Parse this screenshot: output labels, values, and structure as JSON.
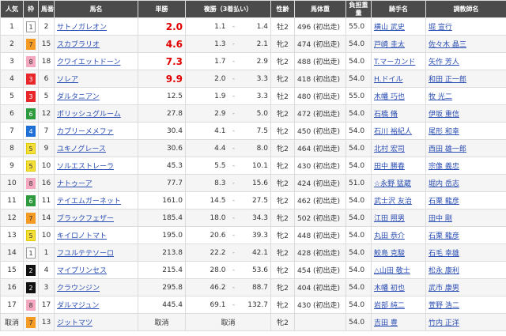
{
  "header": {
    "rank": "人気",
    "gate": "枠",
    "number": "馬番",
    "horse": "馬名",
    "win": "単勝",
    "place": "複勝（3着払い）",
    "sex_age": "性齢",
    "body_weight": "馬体重",
    "carried_weight": "負担重量",
    "jockey": "騎手名",
    "trainer": "調教師名"
  },
  "scratched_label": "取消",
  "gate_colors": {
    "1": {
      "bg": "#ffffff",
      "fg": "#333333",
      "border": "#999999"
    },
    "2": {
      "bg": "#111111",
      "fg": "#ffffff",
      "border": "#111111"
    },
    "3": {
      "bg": "#e8272b",
      "fg": "#ffffff",
      "border": "#e8272b"
    },
    "4": {
      "bg": "#1e6fd6",
      "fg": "#ffffff",
      "border": "#1e6fd6"
    },
    "5": {
      "bg": "#f5e03b",
      "fg": "#333333",
      "border": "#e0c800"
    },
    "6": {
      "bg": "#2e9a3e",
      "fg": "#ffffff",
      "border": "#2e9a3e"
    },
    "7": {
      "bg": "#f59a23",
      "fg": "#333333",
      "border": "#f59a23"
    },
    "8": {
      "bg": "#f4a9c0",
      "fg": "#333333",
      "border": "#f4a9c0"
    }
  },
  "rows": [
    {
      "rank": "1",
      "gate": "1",
      "number": "2",
      "horse": "サトノガレオン",
      "win": "2.0",
      "win_hot": true,
      "place_lo": "1.1",
      "place_hi": "1.4",
      "sex_age": "牡2",
      "body_weight": "496 (初出走)",
      "carried_weight": "55.0",
      "jockey": "横山 武史",
      "trainer": "堀 宣行"
    },
    {
      "rank": "2",
      "gate": "7",
      "number": "15",
      "horse": "スカブラリオ",
      "win": "4.6",
      "win_hot": true,
      "place_lo": "1.3",
      "place_hi": "2.1",
      "sex_age": "牝2",
      "body_weight": "474 (初出走)",
      "carried_weight": "54.0",
      "jockey": "戸崎 圭太",
      "trainer": "佐々木 晶三"
    },
    {
      "rank": "3",
      "gate": "8",
      "number": "18",
      "horse": "クワイエットドーン",
      "win": "7.3",
      "win_hot": true,
      "place_lo": "1.7",
      "place_hi": "2.9",
      "sex_age": "牝2",
      "body_weight": "488 (初出走)",
      "carried_weight": "54.0",
      "jockey": "T.マーカンド",
      "trainer": "矢作 芳人"
    },
    {
      "rank": "4",
      "gate": "3",
      "number": "6",
      "horse": "ソレア",
      "win": "9.9",
      "win_hot": true,
      "place_lo": "2.0",
      "place_hi": "3.3",
      "sex_age": "牝2",
      "body_weight": "418 (初出走)",
      "carried_weight": "54.0",
      "jockey": "H.ドイル",
      "trainer": "和田 正一郎"
    },
    {
      "rank": "5",
      "gate": "3",
      "number": "5",
      "horse": "ダルタニアン",
      "win": "12.5",
      "win_hot": false,
      "place_lo": "1.9",
      "place_hi": "3.3",
      "sex_age": "牡2",
      "body_weight": "480 (初出走)",
      "carried_weight": "55.0",
      "jockey": "木幡 巧也",
      "trainer": "牧 光二"
    },
    {
      "rank": "6",
      "gate": "6",
      "number": "12",
      "horse": "ポリッシュグルーム",
      "win": "27.8",
      "win_hot": false,
      "place_lo": "2.9",
      "place_hi": "5.0",
      "sex_age": "牝2",
      "body_weight": "472 (初出走)",
      "carried_weight": "54.0",
      "jockey": "石橋 脩",
      "trainer": "伊坂 重信"
    },
    {
      "rank": "7",
      "gate": "4",
      "number": "7",
      "horse": "カプリーメメファ",
      "win": "30.4",
      "win_hot": false,
      "place_lo": "4.1",
      "place_hi": "7.5",
      "sex_age": "牝2",
      "body_weight": "450 (初出走)",
      "carried_weight": "54.0",
      "jockey": "石川 裕紀人",
      "trainer": "尾形 和幸"
    },
    {
      "rank": "8",
      "gate": "5",
      "number": "9",
      "horse": "ユキノグレース",
      "win": "30.6",
      "win_hot": false,
      "place_lo": "4.4",
      "place_hi": "8.0",
      "sex_age": "牝2",
      "body_weight": "464 (初出走)",
      "carried_weight": "54.0",
      "jockey": "北村 宏司",
      "trainer": "西田 雄一郎"
    },
    {
      "rank": "9",
      "gate": "5",
      "number": "10",
      "horse": "ソルエストレーラ",
      "win": "45.3",
      "win_hot": false,
      "place_lo": "5.5",
      "place_hi": "10.1",
      "sex_age": "牝2",
      "body_weight": "430 (初出走)",
      "carried_weight": "54.0",
      "jockey": "田中 勝春",
      "trainer": "宗像 義忠"
    },
    {
      "rank": "10",
      "gate": "8",
      "number": "16",
      "horse": "ナトゥーア",
      "win": "77.7",
      "win_hot": false,
      "place_lo": "8.3",
      "place_hi": "15.6",
      "sex_age": "牝2",
      "body_weight": "424 (初出走)",
      "carried_weight": "51.0",
      "jockey": "☆永野 猛蔵",
      "trainer": "堀内 岳志"
    },
    {
      "rank": "11",
      "gate": "6",
      "number": "11",
      "horse": "テイエムガーネット",
      "win": "161.0",
      "win_hot": false,
      "place_lo": "14.5",
      "place_hi": "27.5",
      "sex_age": "牝2",
      "body_weight": "462 (初出走)",
      "carried_weight": "54.0",
      "jockey": "武士沢 友治",
      "trainer": "石栗 龍彦"
    },
    {
      "rank": "12",
      "gate": "7",
      "number": "14",
      "horse": "ブラックフェザー",
      "win": "185.4",
      "win_hot": false,
      "place_lo": "18.0",
      "place_hi": "34.3",
      "sex_age": "牝2",
      "body_weight": "502 (初出走)",
      "carried_weight": "54.0",
      "jockey": "江田 照男",
      "trainer": "田中 剛"
    },
    {
      "rank": "13",
      "gate": "5",
      "number": "10",
      "horse": "キイロノトマト",
      "win": "195.0",
      "win_hot": false,
      "place_lo": "20.6",
      "place_hi": "39.3",
      "sex_age": "牝2",
      "body_weight": "448 (初出走)",
      "carried_weight": "54.0",
      "jockey": "丸田 恭介",
      "trainer": "石栗 龍彦"
    },
    {
      "rank": "14",
      "gate": "1",
      "number": "1",
      "horse": "フユルテテソーロ",
      "win": "213.8",
      "win_hot": false,
      "place_lo": "22.2",
      "place_hi": "42.1",
      "sex_age": "牝2",
      "body_weight": "428 (初出走)",
      "carried_weight": "54.0",
      "jockey": "鮫島 克駿",
      "trainer": "石毛 幸雄"
    },
    {
      "rank": "15",
      "gate": "2",
      "number": "4",
      "horse": "マイプリンセス",
      "win": "215.4",
      "win_hot": false,
      "place_lo": "28.0",
      "place_hi": "53.6",
      "sex_age": "牝2",
      "body_weight": "454 (初出走)",
      "carried_weight": "54.0",
      "jockey": "△山田 敬士",
      "trainer": "松永 康利"
    },
    {
      "rank": "16",
      "gate": "2",
      "number": "3",
      "horse": "クラウンジン",
      "win": "295.8",
      "win_hot": false,
      "place_lo": "46.2",
      "place_hi": "88.7",
      "sex_age": "牝2",
      "body_weight": "404 (初出走)",
      "carried_weight": "54.0",
      "jockey": "木幡 初也",
      "trainer": "武市 康男"
    },
    {
      "rank": "17",
      "gate": "8",
      "number": "17",
      "horse": "ダルマジュン",
      "win": "445.4",
      "win_hot": false,
      "place_lo": "69.1",
      "place_hi": "132.7",
      "sex_age": "牝2",
      "body_weight": "430 (初出走)",
      "carried_weight": "54.0",
      "jockey": "岩部 純二",
      "trainer": "萱野 浩二"
    },
    {
      "rank": "取消",
      "gate": "7",
      "number": "13",
      "horse": "ジットマツ",
      "win": "取消",
      "win_hot": false,
      "place_lo": "取消",
      "place_hi": "",
      "sex_age": "牝2",
      "body_weight": "",
      "carried_weight": "54.0",
      "jockey": "吉田 豊",
      "trainer": "竹内 正洋",
      "scratched": true
    }
  ]
}
